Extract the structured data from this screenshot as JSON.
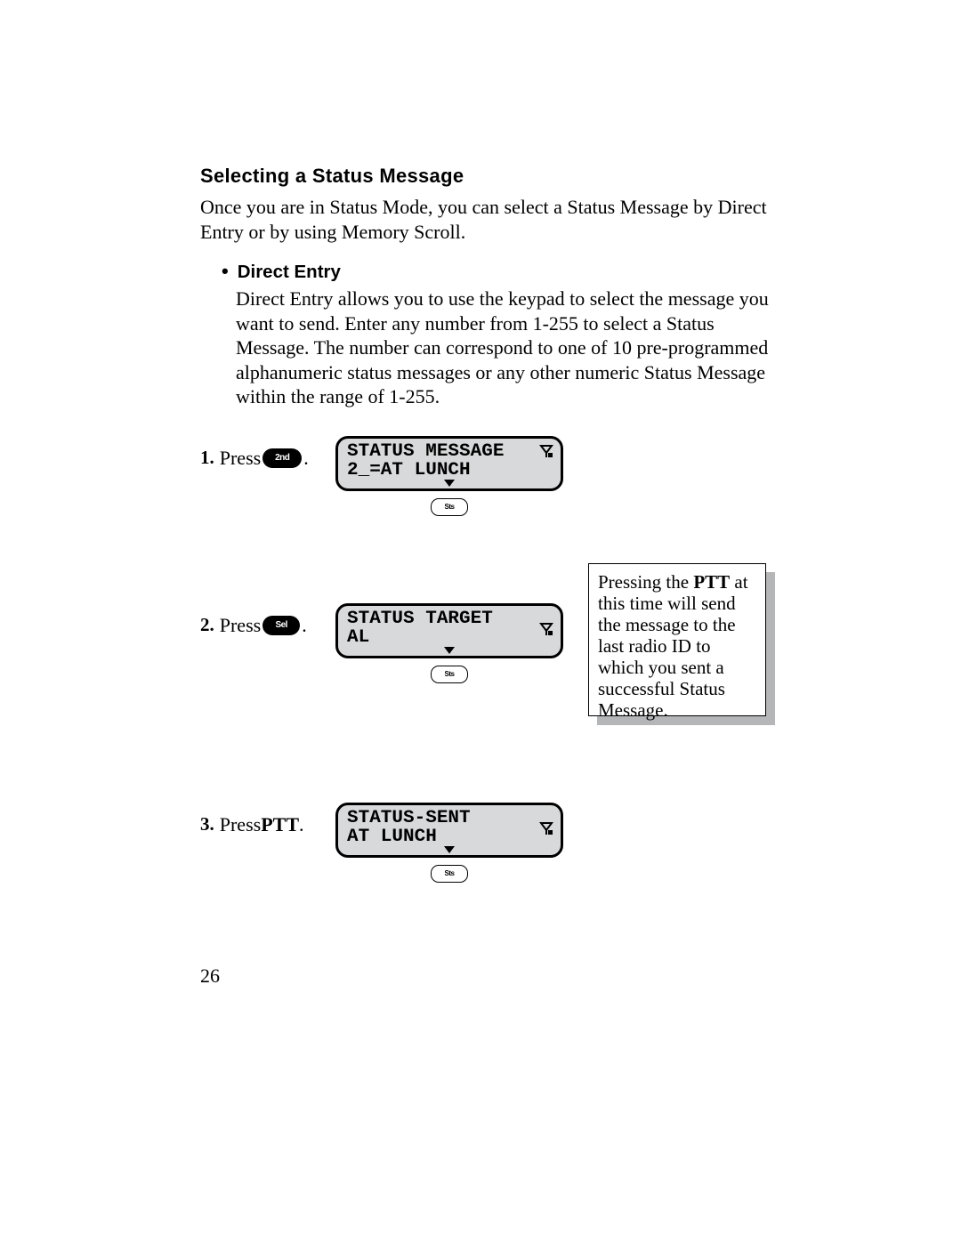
{
  "heading": "Selecting a Status Message",
  "intro": "Once you are in Status Mode, you can select a Status Message by Direct Entry or by using Memory Scroll.",
  "bullet": {
    "label": "Direct Entry",
    "body": "Direct Entry allows you to use the keypad to select the message you want to send. Enter any number from 1-255 to select a Status Message. The number can correspond to one of 10 pre-programmed alphanumeric status messages or any other numeric Status Message within the range of 1-255."
  },
  "steps": [
    {
      "num": "1.",
      "prefix": "Press",
      "button_icon": "2nd",
      "suffix": ".",
      "lcd": {
        "line1": "STATUS MESSAGE",
        "line2": "2_=AT LUNCH"
      },
      "sts_label": "Sts"
    },
    {
      "num": "2.",
      "prefix": "Press",
      "button_icon": "Sel",
      "suffix": ".",
      "lcd": {
        "line1": "STATUS TARGET",
        "line2": "AL"
      },
      "sts_label": "Sts"
    },
    {
      "num": "3.",
      "prefix": "Press ",
      "bold": "PTT",
      "suffix": ".",
      "lcd": {
        "line1": "STATUS-SENT",
        "line2": "AT LUNCH"
      },
      "sts_label": "Sts"
    }
  ],
  "note": {
    "t1": "Pressing the ",
    "bold": "PTT",
    "t2": " at this time will send the message to the last radio ID to which you sent a successful Status Message."
  },
  "page_number": "26"
}
